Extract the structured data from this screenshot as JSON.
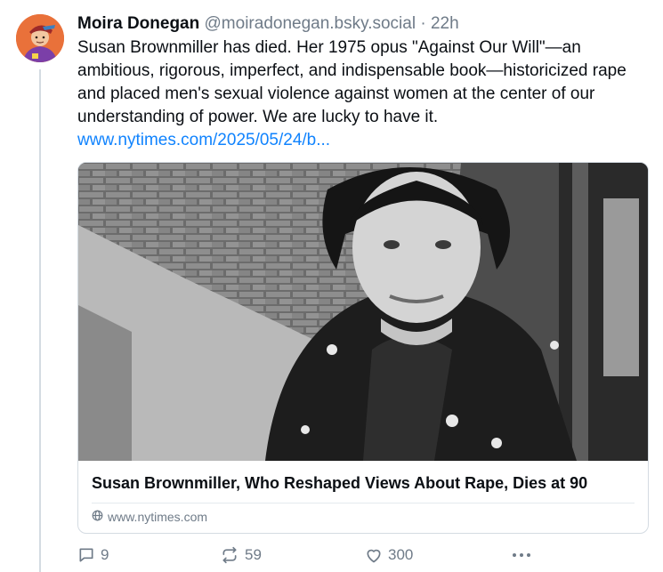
{
  "post": {
    "author_name": "Moira Donegan",
    "author_handle": "@moiradonegan.bsky.social",
    "separator": "·",
    "timestamp": "22h",
    "text": "Susan Brownmiller has died. Her 1975 opus \"Against Our Will\"—an ambitious, rigorous, imperfect, and indispensable book—historicized rape and placed men's sexual violence against women at the center of our understanding of power. We are lucky to have it.",
    "link_text": "www.nytimes.com/2025/05/24/b..."
  },
  "card": {
    "title": "Susan Brownmiller, Who Reshaped Views About Rape, Dies at 90",
    "domain": "www.nytimes.com"
  },
  "actions": {
    "reply_count": "9",
    "repost_count": "59",
    "like_count": "300"
  },
  "icons": {
    "reply": "speech-bubble-icon",
    "repost": "repost-arrows-icon",
    "like": "heart-icon",
    "more": "more-dots-icon",
    "domain": "globe-icon"
  },
  "colors": {
    "link": "#1083fe",
    "muted": "#6f7b88",
    "border": "#d4dbe2"
  }
}
